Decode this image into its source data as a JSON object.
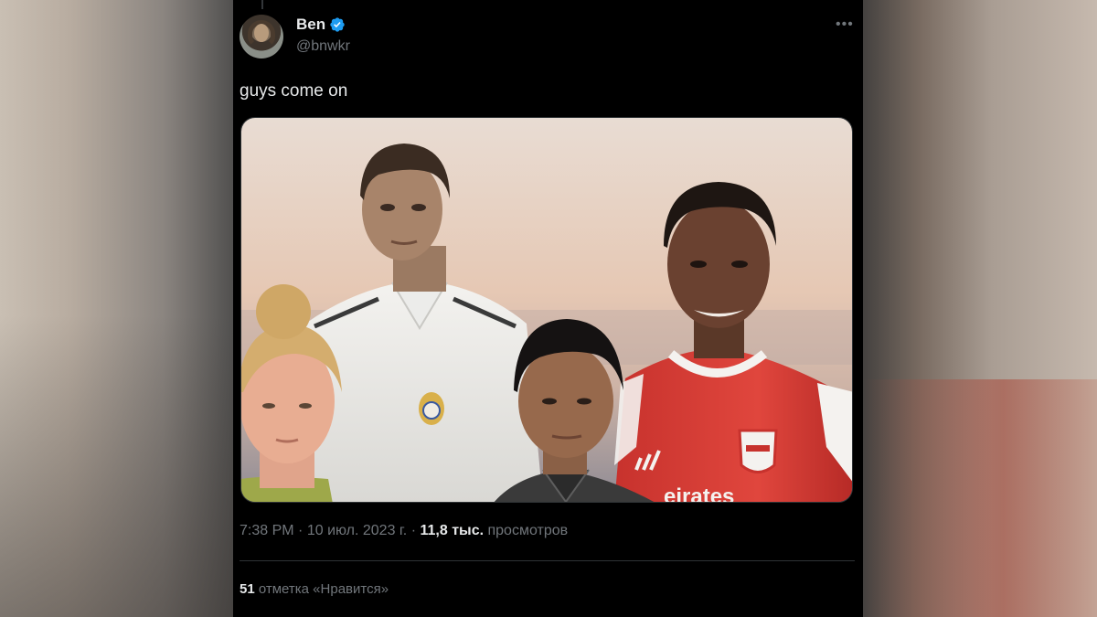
{
  "author": {
    "display_name": "Ben",
    "handle": "@bnwkr",
    "verified": true
  },
  "tweet": {
    "text": "guys come on",
    "media": {
      "type": "image",
      "content": "Four football player portraits from a video game",
      "visible_text": [
        "eirates"
      ]
    }
  },
  "meta": {
    "time": "7:38 PM",
    "separator": "·",
    "date": "10 июл. 2023 г.",
    "views_count": "11,8 тыс.",
    "views_label": "просмотров"
  },
  "stats": {
    "likes_count": "51",
    "likes_label": "отметка «Нравится»"
  },
  "icons": {
    "verified": "verified-badge-icon",
    "more": "more-options-icon"
  },
  "colors": {
    "background": "#000000",
    "text_primary": "#e7e9ea",
    "text_secondary": "#71767b",
    "divider": "#2f3336",
    "verified": "#1d9bf0"
  }
}
